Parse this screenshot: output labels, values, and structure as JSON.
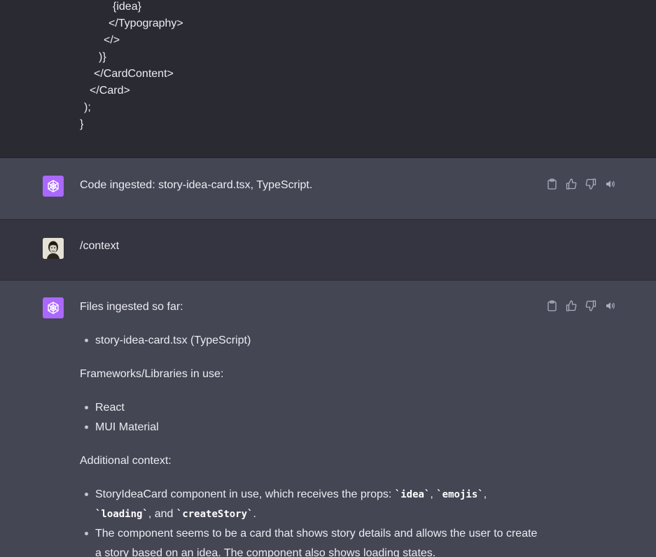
{
  "code": {
    "lines": [
      {
        "text": "{idea}"
      },
      {
        "text": "</Typography>"
      },
      {
        "text": "</>"
      },
      {
        "text": ")}"
      },
      {
        "text": "</CardContent>"
      },
      {
        "text": "</Card>"
      },
      {
        "text": ");"
      },
      {
        "text": "}"
      }
    ]
  },
  "messages": {
    "m1": {
      "text": "Code ingested: story-idea-card.tsx, TypeScript."
    },
    "m2": {
      "text": "/context"
    },
    "m3": {
      "heading1": "Files ingested so far:",
      "files": [
        "story-idea-card.tsx (TypeScript)"
      ],
      "heading2": "Frameworks/Libraries in use:",
      "libraries": [
        "React",
        "MUI Material"
      ],
      "heading3": "Additional context:",
      "context1": {
        "prefix": "StoryIdeaCard component in use, which receives the props: ",
        "idea": "`idea`",
        "sep1": ", ",
        "emojis": "`emojis`",
        "sep2": ",",
        "loading": "`loading`",
        "sep3": ", and ",
        "createStory": "`createStory`",
        "suffix": "."
      },
      "context2": {
        "line1": "The component seems to be a card that shows story details and allows the user to create",
        "line2": "a story based on an idea. The component also shows loading states."
      }
    }
  },
  "actions": {
    "copy": "clipboard-icon",
    "like": "thumbs-up-icon",
    "dislike": "thumbs-down-icon",
    "speak": "speaker-icon"
  },
  "colors": {
    "assistant_bg": "#444654",
    "user_bg": "#343541",
    "code_bg": "#2a2b32",
    "gpt_avatar": "#ab68ff"
  }
}
